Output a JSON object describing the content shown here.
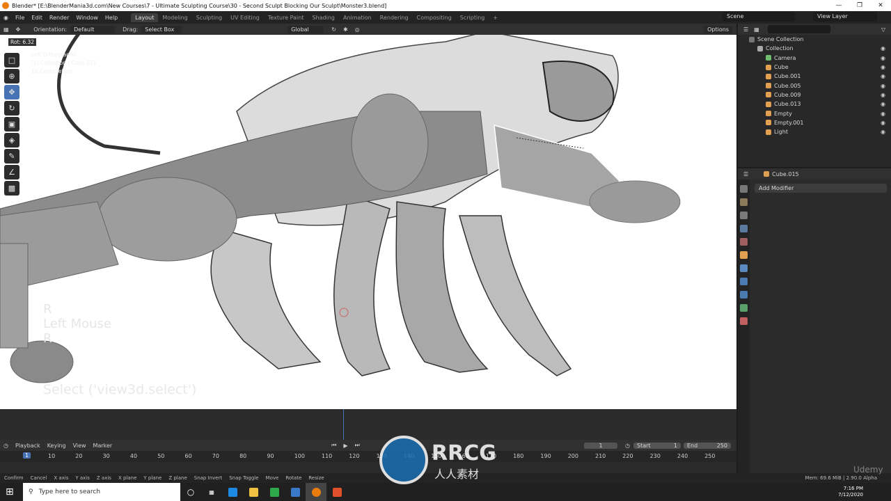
{
  "titlebar": {
    "title": "Blender* [E:\\BlenderMania3d.com\\New Courses\\7 - Ultimate Sculpting Course\\30 - Second Sculpt Blocking Our Sculpt\\Monster3.blend]"
  },
  "menu": [
    "File",
    "Edit",
    "Render",
    "Window",
    "Help"
  ],
  "workspaces": [
    "Layout",
    "Modeling",
    "Sculpting",
    "UV Editing",
    "Texture Paint",
    "Shading",
    "Animation",
    "Rendering",
    "Compositing",
    "Scripting"
  ],
  "scene": "Scene",
  "viewlayer": "View Layer",
  "toolheader": {
    "orientation_label": "Orientation:",
    "orientation": "Default",
    "drag_label": "Drag:",
    "drag": "Select Box",
    "transform": "Global",
    "options": "Options"
  },
  "overlay": {
    "rot": "Rot: 6.32",
    "view": "Left Orthographic",
    "object": "(1) Collection | Cube.015",
    "scale": "10 Centimeters"
  },
  "keyhints": [
    "R",
    "Left Mouse",
    "R"
  ],
  "operator": "Select ('view3d.select')",
  "outliner": {
    "root": "Scene Collection",
    "collection": "Collection",
    "items": [
      {
        "name": "Camera",
        "color": "#6fbe6f"
      },
      {
        "name": "Cube",
        "color": "#e0a050"
      },
      {
        "name": "Cube.001",
        "color": "#e0a050"
      },
      {
        "name": "Cube.005",
        "color": "#e0a050"
      },
      {
        "name": "Cube.009",
        "color": "#e0a050"
      },
      {
        "name": "Cube.013",
        "color": "#e0a050"
      },
      {
        "name": "Empty",
        "color": "#e0a050"
      },
      {
        "name": "Empty.001",
        "color": "#e0a050"
      },
      {
        "name": "Light",
        "color": "#e0a050"
      }
    ]
  },
  "properties": {
    "object": "Cube.015",
    "add_modifier": "Add Modifier"
  },
  "timeline": {
    "menus": [
      "Playback",
      "Keying",
      "View",
      "Marker"
    ],
    "current": "1",
    "start_label": "Start",
    "start": "1",
    "end_label": "End",
    "end": "250",
    "frames": [
      "10",
      "20",
      "30",
      "40",
      "50",
      "60",
      "70",
      "80",
      "90",
      "100",
      "110",
      "120",
      "130",
      "140",
      "150",
      "160",
      "170",
      "180",
      "190",
      "200",
      "210",
      "220",
      "230",
      "240",
      "250"
    ],
    "cur_frame": "1"
  },
  "status": {
    "items": [
      "Confirm",
      "Cancel",
      "X axis",
      "Y axis",
      "Z axis",
      "X plane",
      "Y plane",
      "Z plane",
      "Snap Invert",
      "Snap Toggle",
      "Move",
      "Rotate",
      "Resize"
    ],
    "mem": "Mem: 69.6 MiB | 2.90.0 Alpha"
  },
  "taskbar": {
    "search": "Type here to search",
    "time": "7:16 PM",
    "date": "7/12/2020"
  },
  "watermark": {
    "brand": "RRCG",
    "sub": "人人素材",
    "udemy": "Udemy"
  }
}
